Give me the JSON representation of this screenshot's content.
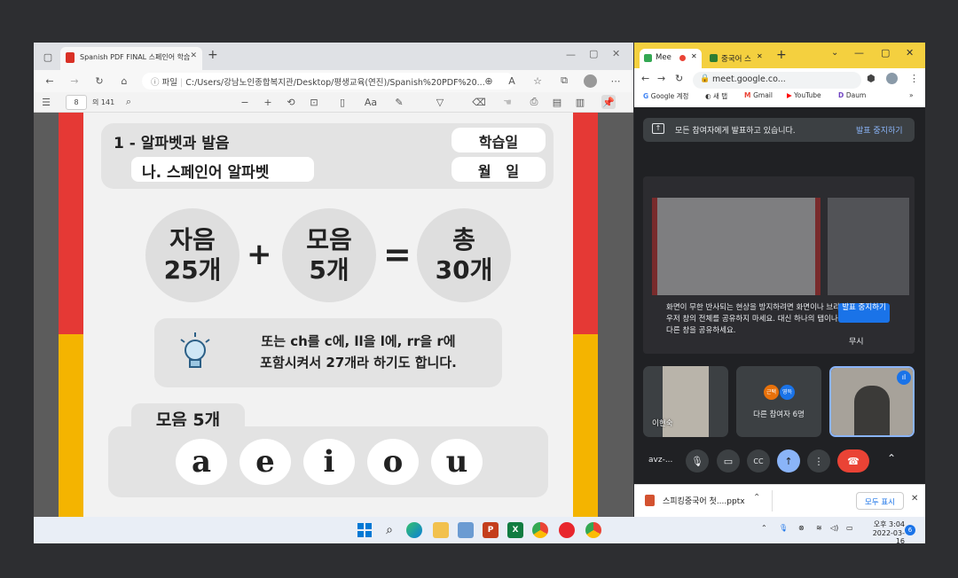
{
  "edge": {
    "tab_title": "Spanish PDF FINAL 스페인어 학습",
    "new_tab": "+",
    "url_prefix": "파일",
    "url": "C:/Users/강남노인종합복지관/Desktop/평생교육(연진)/Spanish%20PDF%20...",
    "page_number": "8",
    "page_total": "의 141"
  },
  "pdf": {
    "lesson_title": "1 - 알파벳과 발음",
    "lesson_subtitle": "나. 스페인어 알파벳",
    "study_day_label": "학습일",
    "month_day": "월   일",
    "consonants_line1": "자음",
    "consonants_line2": "25개",
    "plus": "+",
    "vowels_line1": "모음",
    "vowels_line2": "5개",
    "equals": "=",
    "total_line1": "총",
    "total_line2": "30개",
    "note_line1": "또는 ch를 c에, ll을 l에, rr을 r에",
    "note_line2": "포함시켜서 27개라 하기도 합니다.",
    "vowel_heading": "모음 5개",
    "vowels": [
      "a",
      "e",
      "i",
      "o",
      "u"
    ]
  },
  "chrome": {
    "tab1": "Mee",
    "tab2": "중국어 스",
    "url": "meet.google.co...",
    "bookmarks": [
      "Google 계정",
      "새 탭",
      "Gmail",
      "YouTube",
      "Daum"
    ],
    "bm_more": "»"
  },
  "meet": {
    "presenting_text": "모든 참여자에게 발표하고 있습니다.",
    "stop_presenting": "발표 중지하기",
    "warning_text": "화면이 무한 반사되는 현상을 방지하려면 화면이나 브라우저 창의 전체를 공유하지 마세요. 대신 하나의 탭이나 다른 창을 공유하세요.",
    "warning_stop": "발표 중지하기",
    "warning_ignore": "무시",
    "participant1_name": "이현숙",
    "others_label": "다른 참여자 6명",
    "avatar1": "근택",
    "avatar2": "영득",
    "meeting_code": "avz-..."
  },
  "download": {
    "file_name": "스피킹중국어 첫....pptx",
    "show_all": "모두 표시"
  },
  "taskbar": {
    "time": "오후 3:04",
    "date": "2022-03-16",
    "notif_count": "6"
  },
  "colors": {
    "stripe_red": "#e53935",
    "stripe_yellow": "#f4b400",
    "chrome_tab_yellow": "#f4d03f",
    "meet_blue": "#1a73e8",
    "end_call_red": "#ea4335"
  }
}
